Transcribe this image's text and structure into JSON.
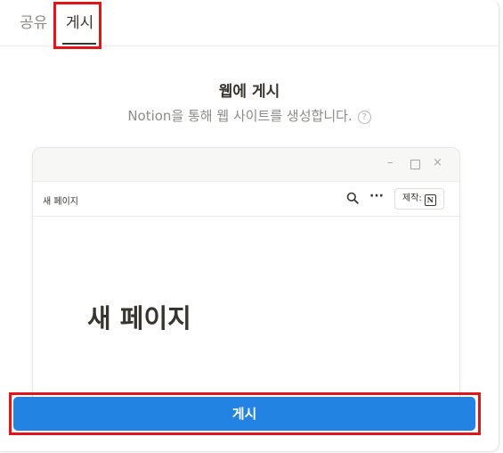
{
  "tabs": {
    "share_label": "공유",
    "publish_label": "게시"
  },
  "publish": {
    "title": "웹에 게시",
    "subtitle": "Notion을 통해 웹 사이트를 생성합니다.",
    "help_icon": "?",
    "button_label": "게시"
  },
  "preview": {
    "window_controls": {
      "minimize": "–",
      "close": "×"
    },
    "nav_title": "새 페이지",
    "more_label": "···",
    "made_with_label": "제작:",
    "notion_logo": "N",
    "page_heading": "새 페이지"
  },
  "colors": {
    "accent": "#2383e2",
    "highlight": "#e0161b",
    "text": "#37352f",
    "muted": "#8d8c88"
  },
  "icons": [
    "help-icon",
    "minimize-icon",
    "maximize-icon",
    "close-icon",
    "search-icon",
    "more-icon",
    "notion-logo-icon"
  ]
}
